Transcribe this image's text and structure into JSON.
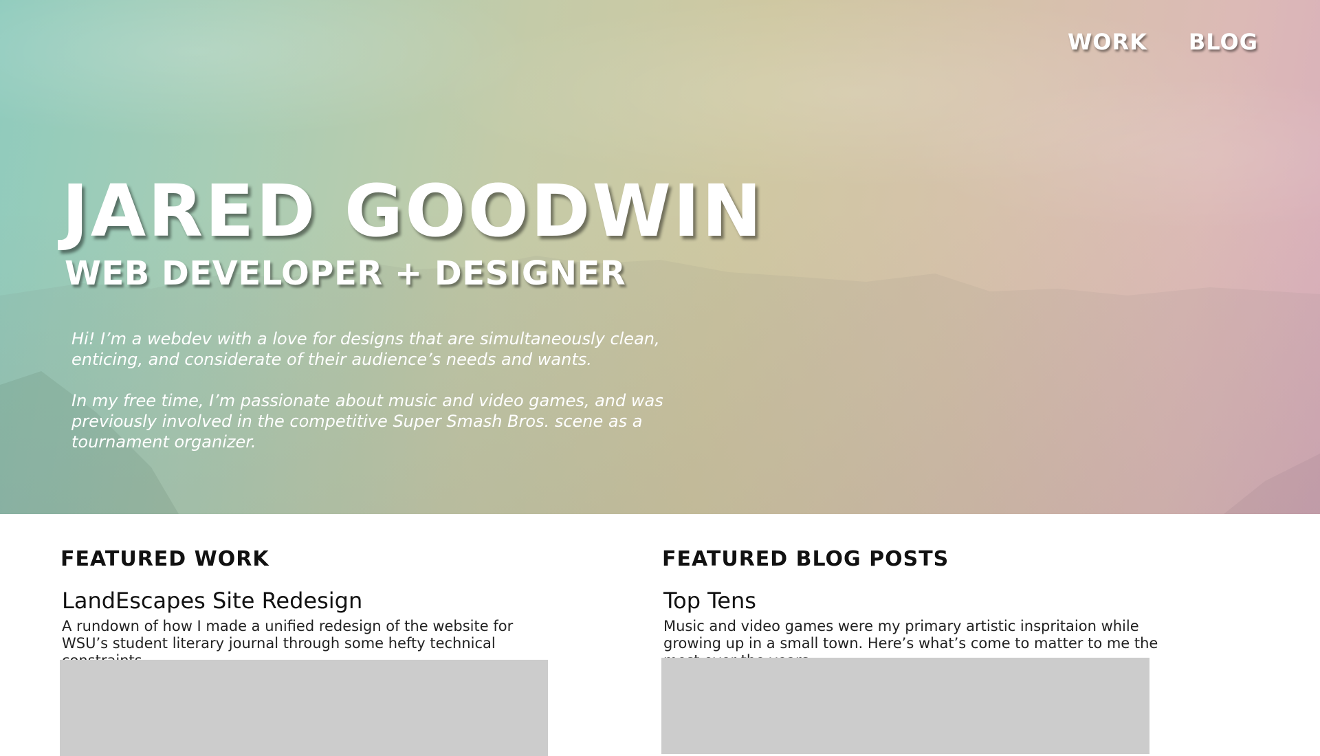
{
  "nav": {
    "work_label": "WORK",
    "blog_label": "BLOG"
  },
  "hero": {
    "title": "JARED GOODWIN",
    "subtitle": "WEB DEVELOPER + DESIGNER",
    "bio": [
      "Hi! I’m a webdev with a love for designs that are simultaneously clean, enticing, and considerate of their audience’s needs and wants.",
      "In my free time, I’m passionate about music and video games, and was previously involved in the competitive Super Smash Bros. scene as a tournament organizer."
    ]
  },
  "featured_work": {
    "heading": "FEATURED WORK",
    "item_title": "LandEscapes Site Redesign",
    "item_description": "A rundown of how I made a unified redesign of the website for WSU’s student literary journal through some hefty technical constraints."
  },
  "featured_blog": {
    "heading": "FEATURED BLOG POSTS",
    "item_title": "Top Tens",
    "item_description": "Music and video games were my primary artistic inspritaion while growing up in a small town. Here’s what’s come to matter to me the most over the years."
  },
  "colors": {
    "hero_teal": "#8fcbbd",
    "hero_sand": "#cfc8a2",
    "hero_pink": "#d9aebc",
    "placeholder_gray": "#cccccc",
    "heading_text": "#111111"
  }
}
